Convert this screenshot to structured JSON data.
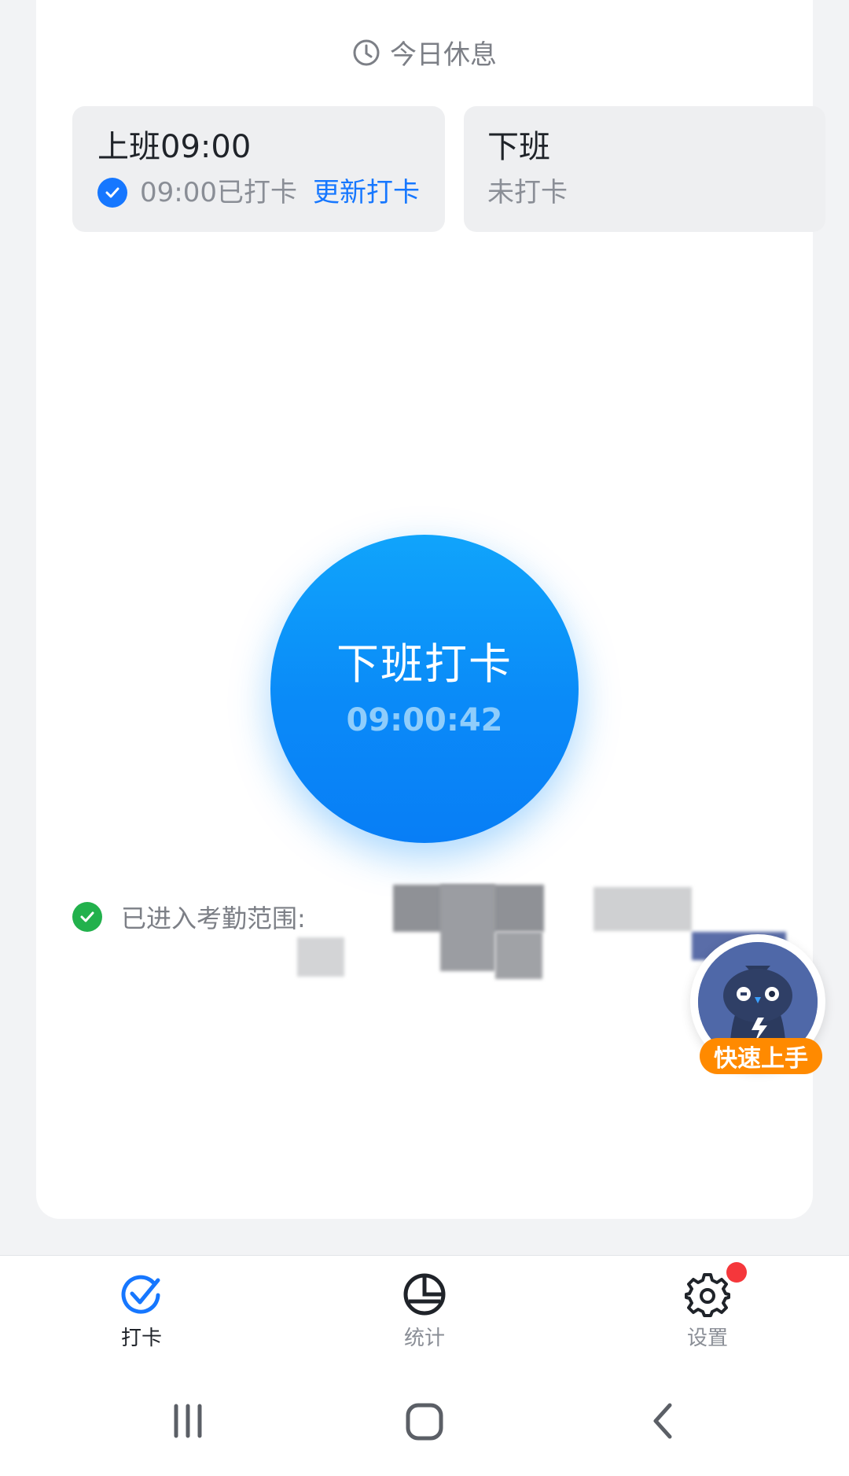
{
  "header": {
    "rest_text": "今日休息",
    "rest_icon": "clock-icon"
  },
  "shifts": {
    "on": {
      "title": "上班09:00",
      "status_text": "09:00已打卡",
      "update_label": "更新打卡"
    },
    "off": {
      "title": "下班",
      "status_text": "未打卡"
    }
  },
  "punch": {
    "label": "下班打卡",
    "time": "09:00:42"
  },
  "range": {
    "label": "已进入考勤范围:"
  },
  "quick_start": {
    "label": "快速上手"
  },
  "tabs": [
    {
      "label": "打卡",
      "icon": "check-tab-icon",
      "active": true
    },
    {
      "label": "统计",
      "icon": "pie-chart-icon",
      "active": false
    },
    {
      "label": "设置",
      "icon": "gear-icon",
      "active": false
    }
  ],
  "colors": {
    "primary": "#1677ff",
    "punch": "#0a8af8",
    "success": "#22b14c",
    "badge": "#ff8a00",
    "notification": "#f5373b"
  }
}
